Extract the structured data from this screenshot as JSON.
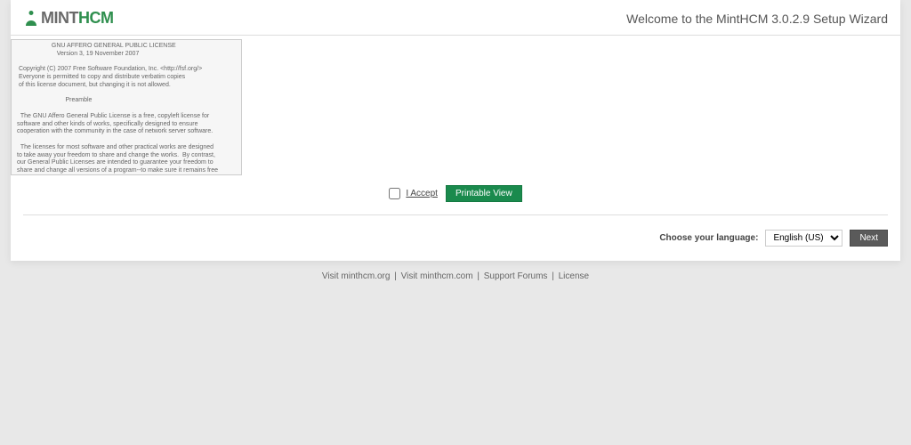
{
  "header": {
    "logo_mint": "MINT",
    "logo_hcm": "HCM",
    "title": "Welcome to the MintHCM 3.0.2.9 Setup Wizard"
  },
  "license": {
    "text": "                    GNU AFFERO GENERAL PUBLIC LICENSE\n                       Version 3, 19 November 2007\n\n Copyright (C) 2007 Free Software Foundation, Inc. <http://fsf.org/>\n Everyone is permitted to copy and distribute verbatim copies\n of this license document, but changing it is not allowed.\n\n                            Preamble\n\n  The GNU Affero General Public License is a free, copyleft license for\nsoftware and other kinds of works, specifically designed to ensure\ncooperation with the community in the case of network server software.\n\n  The licenses for most software and other practical works are designed\nto take away your freedom to share and change the works.  By contrast,\nour General Public Licenses are intended to guarantee your freedom to\nshare and change all versions of a program--to make sure it remains free\nsoftware for all its users.\n\n  When we speak of free software, we are referring to freedom, not"
  },
  "accept": {
    "label": "I Accept",
    "printable": "Printable View"
  },
  "footer": {
    "lang_label": "Choose your language:",
    "lang_value": "English (US)",
    "next": "Next"
  },
  "links": {
    "l1": "Visit minthcm.org",
    "l2": "Visit minthcm.com",
    "l3": "Support Forums",
    "l4": "License"
  }
}
